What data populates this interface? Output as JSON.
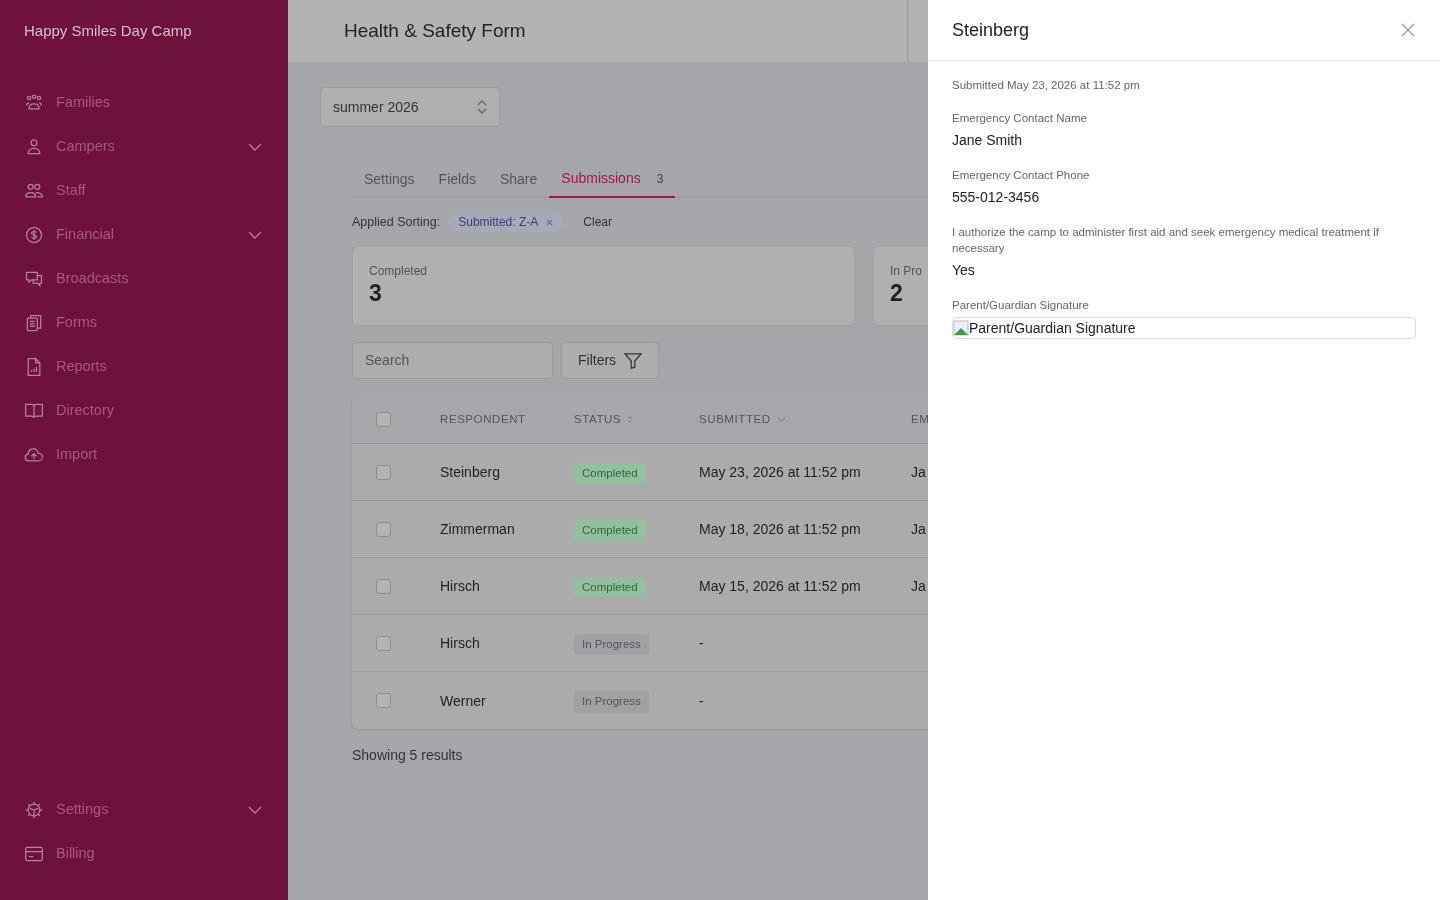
{
  "sidebar": {
    "brand": "Happy Smiles Day Camp",
    "items": [
      {
        "label": "Families",
        "expandable": false
      },
      {
        "label": "Campers",
        "expandable": true
      },
      {
        "label": "Staff",
        "expandable": false
      },
      {
        "label": "Financial",
        "expandable": true
      },
      {
        "label": "Broadcasts",
        "expandable": false
      },
      {
        "label": "Forms",
        "expandable": false
      },
      {
        "label": "Reports",
        "expandable": false
      },
      {
        "label": "Directory",
        "expandable": false
      },
      {
        "label": "Import",
        "expandable": false
      }
    ],
    "bottom_items": [
      {
        "label": "Settings",
        "expandable": true
      },
      {
        "label": "Billing",
        "expandable": false
      }
    ]
  },
  "header": {
    "title": "Health & Safety Form"
  },
  "season_select": {
    "value": "summer 2026"
  },
  "tabs": [
    {
      "label": "Settings",
      "selected": false
    },
    {
      "label": "Fields",
      "selected": false
    },
    {
      "label": "Share",
      "selected": false
    },
    {
      "label": "Submissions",
      "count": "3",
      "selected": true
    }
  ],
  "sorting": {
    "label": "Applied Sorting:",
    "chip": "Submitted: Z-A",
    "clear": "Clear"
  },
  "stats": [
    {
      "label": "Completed",
      "value": "3"
    },
    {
      "label": "In Pro",
      "value": "2"
    }
  ],
  "search": {
    "placeholder": "Search"
  },
  "filters_button": "Filters",
  "table": {
    "columns": [
      {
        "label": "RESPONDENT",
        "kind": "plain"
      },
      {
        "label": "STATUS",
        "kind": "updown"
      },
      {
        "label": "SUBMITTED",
        "kind": "down"
      },
      {
        "label": "EM",
        "kind": "plain"
      }
    ],
    "rows": [
      {
        "respondent": "Steinberg",
        "status": "Completed",
        "kind": "completed",
        "submitted": "May 23, 2026 at 11:52 pm",
        "column_4": "Ja",
        "checked": false
      },
      {
        "respondent": "Zimmerman",
        "status": "Completed",
        "kind": "completed",
        "submitted": "May 18, 2026 at 11:52 pm",
        "column_4": "Ja",
        "checked": false
      },
      {
        "respondent": "Hirsch",
        "status": "Completed",
        "kind": "completed",
        "submitted": "May 15, 2026 at 11:52 pm",
        "column_4": "Ja",
        "checked": false
      },
      {
        "respondent": "Hirsch",
        "status": "In Progress",
        "kind": "progress",
        "submitted": "-",
        "checked": false
      },
      {
        "respondent": "Werner",
        "status": "In Progress",
        "kind": "progress",
        "submitted": "-",
        "checked": false
      }
    ],
    "all_checked": false
  },
  "results": "Showing 5 results",
  "drawer": {
    "title": "Steinberg",
    "submitted": "Submitted May 23, 2026 at 11:52 pm",
    "fields": [
      {
        "kind": "text",
        "label": "Emergency Contact Name",
        "value": "Jane Smith"
      },
      {
        "kind": "text",
        "label": "Emergency Contact Phone",
        "value": "555-012-3456"
      },
      {
        "kind": "text",
        "label": "I authorize the camp to administer first aid and seek emergency medical treatment if necessary",
        "value": "Yes"
      },
      {
        "kind": "image",
        "label": "Parent/Guardian Signature",
        "value": "Parent/Guardian Signature"
      }
    ]
  }
}
